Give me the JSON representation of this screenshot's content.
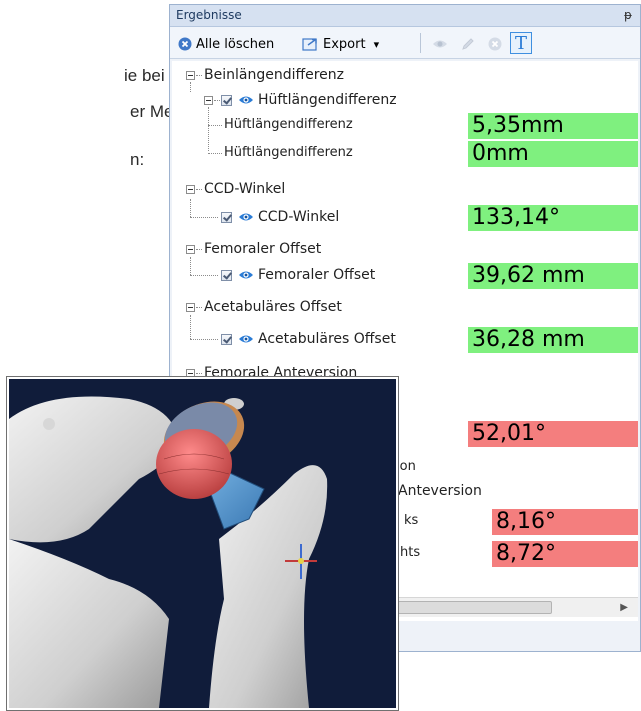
{
  "document": {
    "lines": [
      "ie bei der",
      "er Messun-",
      "n:"
    ]
  },
  "panel": {
    "title": "Ergebnisse",
    "pin_icon": "pin-icon",
    "toolbar": {
      "delete_all_label": "Alle löschen",
      "export_label": "Export",
      "dropdown_glyph": "▾",
      "text_button": "T"
    }
  },
  "tree": {
    "groups": [
      {
        "label": "Beinlängendifferenz",
        "child": "Hüftlängendifferenz",
        "subitems": [
          {
            "label": "Hüftlängendifferenz",
            "value": "5,35mm",
            "status": "ok"
          },
          {
            "label": "Hüftlängendifferenz",
            "value": "0mm",
            "status": "ok"
          }
        ]
      },
      {
        "label": "CCD-Winkel",
        "child": "CCD-Winkel",
        "value": "133,14°",
        "status": "ok"
      },
      {
        "label": "Femoraler Offset",
        "child": "Femoraler Offset",
        "value": "39,62 mm",
        "status": "ok"
      },
      {
        "label": "Acetabuläres Offset",
        "child": "Acetabuläres Offset",
        "value": "36,28 mm",
        "status": "ok"
      },
      {
        "label": "Femorale Anteversion",
        "value": "52,01°",
        "status": "warn",
        "partial": [
          "ion",
          "Anteversion",
          "ks",
          "hts"
        ],
        "subvalues": [
          "8,16°",
          "8,72°"
        ]
      }
    ]
  },
  "colors": {
    "ok": "#7ff07f",
    "warn": "#f47e7e",
    "accent": "#2b7cd6"
  }
}
